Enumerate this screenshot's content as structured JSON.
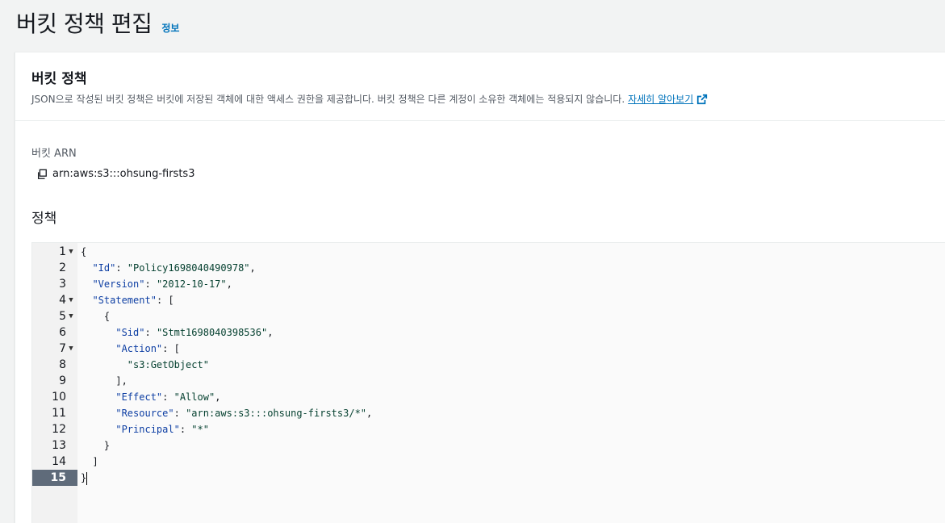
{
  "header": {
    "title": "버킷 정책 편집",
    "info_link": "정보"
  },
  "panel": {
    "title": "버킷 정책",
    "description": "JSON으로 작성된 버킷 정책은 버킷에 저장된 객체에 대한 액세스 권한을 제공합니다. 버킷 정책은 다른 계정이 소유한 객체에는 적용되지 않습니다.",
    "learn_more": "자세히 알아보기"
  },
  "arn": {
    "label": "버킷 ARN",
    "value": "arn:aws:s3:::ohsung-firsts3"
  },
  "policy": {
    "label": "정책"
  },
  "editor": {
    "active_line": 15,
    "lines": [
      {
        "num": "1",
        "fold": true,
        "text": "{"
      },
      {
        "num": "2",
        "fold": false,
        "text": "  \"Id\": \"Policy1698040490978\","
      },
      {
        "num": "3",
        "fold": false,
        "text": "  \"Version\": \"2012-10-17\","
      },
      {
        "num": "4",
        "fold": true,
        "text": "  \"Statement\": ["
      },
      {
        "num": "5",
        "fold": true,
        "text": "    {"
      },
      {
        "num": "6",
        "fold": false,
        "text": "      \"Sid\": \"Stmt1698040398536\","
      },
      {
        "num": "7",
        "fold": true,
        "text": "      \"Action\": ["
      },
      {
        "num": "8",
        "fold": false,
        "text": "        \"s3:GetObject\""
      },
      {
        "num": "9",
        "fold": false,
        "text": "      ],"
      },
      {
        "num": "10",
        "fold": false,
        "text": "      \"Effect\": \"Allow\","
      },
      {
        "num": "11",
        "fold": false,
        "text": "      \"Resource\": \"arn:aws:s3:::ohsung-firsts3/*\","
      },
      {
        "num": "12",
        "fold": false,
        "text": "      \"Principal\": \"*\""
      },
      {
        "num": "13",
        "fold": false,
        "text": "    }"
      },
      {
        "num": "14",
        "fold": false,
        "text": "  ]"
      },
      {
        "num": "15",
        "fold": false,
        "text": "}"
      }
    ]
  },
  "icons": {
    "copy": "copy-icon",
    "external": "external-link-icon",
    "fold": "fold-arrow-icon"
  }
}
